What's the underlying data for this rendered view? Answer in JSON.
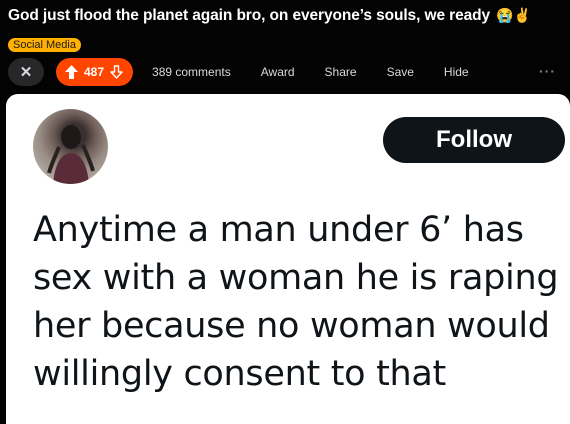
{
  "post": {
    "title": "God just flood the planet again bro, on everyone’s souls, we ready",
    "title_emoji": "😭✌️",
    "flair": "Social Media"
  },
  "actions": {
    "close_icon": "close-icon",
    "score": "487",
    "comments": "389 comments",
    "award": "Award",
    "share": "Share",
    "save": "Save",
    "hide": "Hide",
    "more": "···"
  },
  "tweet": {
    "follow_label": "Follow",
    "text": "Anytime a man under 6’ has sex with a woman he is raping her because no woman would willingly consent to that"
  },
  "colors": {
    "background": "#030303",
    "flair": "#ffb000",
    "upvote_accent": "#ff4500",
    "follow_button": "#0f1419",
    "card": "#ffffff"
  }
}
